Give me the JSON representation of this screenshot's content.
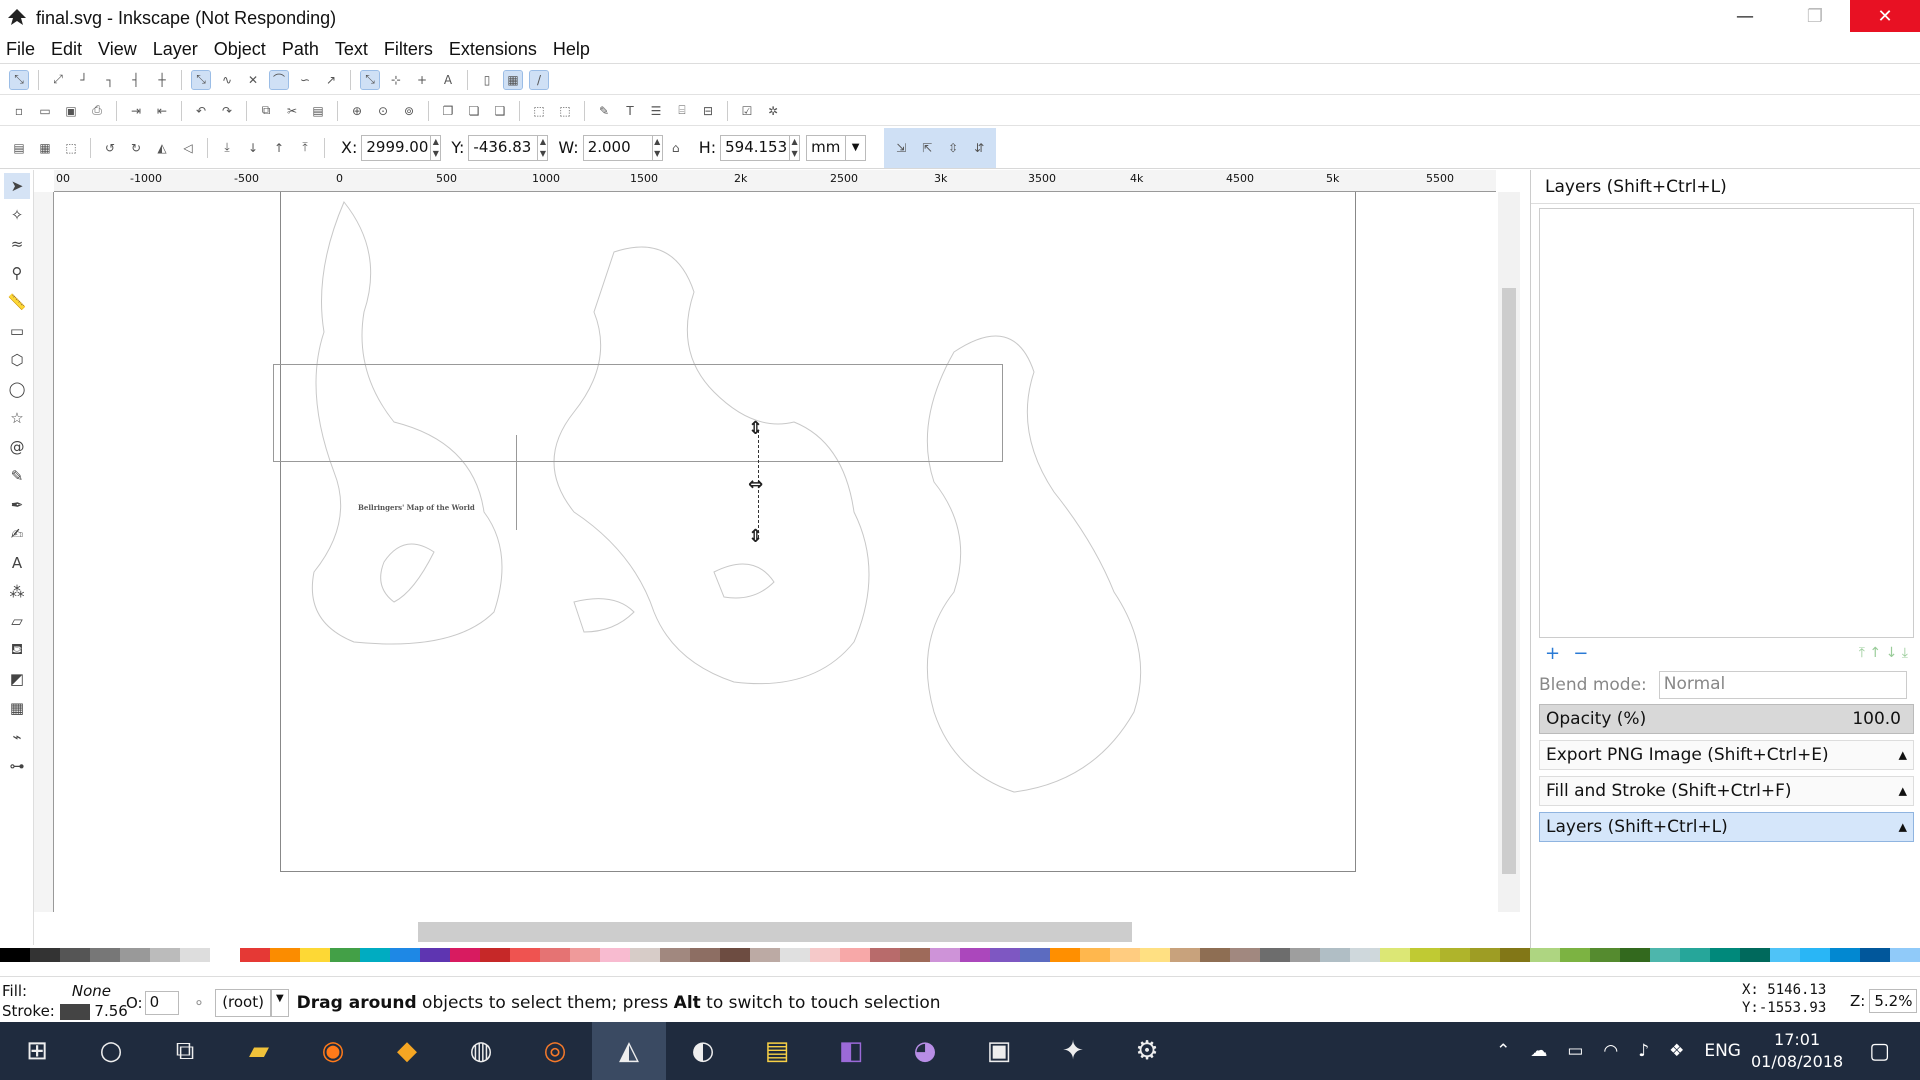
{
  "window": {
    "title": "final.svg - Inkscape (Not Responding)",
    "minimize": "—",
    "maximize": "❐",
    "close": "✕"
  },
  "menu": [
    "File",
    "Edit",
    "View",
    "Layer",
    "Object",
    "Path",
    "Text",
    "Filters",
    "Extensions",
    "Help"
  ],
  "toolbar": {
    "x_label": "X:",
    "x_value": "2999.00",
    "y_label": "Y:",
    "y_value": "-436.83",
    "w_label": "W:",
    "w_value": "2.000",
    "h_label": "H:",
    "h_value": "594.153",
    "unit": "mm"
  },
  "ruler": {
    "h_ticks": [
      "00",
      "-1000",
      "-500",
      "0",
      "500",
      "1000",
      "1500",
      "2k",
      "2500",
      "3k",
      "3500",
      "4k",
      "4500",
      "5k",
      "5500"
    ]
  },
  "canvas": {
    "map_title": "Bellringers' Map of the World"
  },
  "layers_panel": {
    "title": "Layers (Shift+Ctrl+L)",
    "blend_label": "Blend mode:",
    "blend_value": "Normal",
    "opacity_label": "Opacity (%)",
    "opacity_value": "100.0",
    "docks": [
      "Export PNG Image (Shift+Ctrl+E)",
      "Fill and Stroke (Shift+Ctrl+F)",
      "Layers (Shift+Ctrl+L)"
    ]
  },
  "palette_colors": [
    "#000000",
    "#333333",
    "#555555",
    "#777777",
    "#999999",
    "#bbbbbb",
    "#dddddd",
    "#ffffff",
    "#e53935",
    "#fb8c00",
    "#fdd835",
    "#43a047",
    "#00acc1",
    "#1e88e5",
    "#5e35b1",
    "#d81b60",
    "#c62828",
    "#ef5350",
    "#e57373",
    "#ef9a9a",
    "#f8bbd0",
    "#d7ccc8",
    "#a1887f",
    "#8d6e63",
    "#6d4c41",
    "#bcaaa4",
    "#e0e0e0",
    "#f5c9c9",
    "#f7a8a8",
    "#b86b6b",
    "#9e6a5a",
    "#ce93d8",
    "#ab47bc",
    "#7e57c2",
    "#5c6bc0",
    "#ff8f00",
    "#ffb74d",
    "#ffcc80",
    "#ffe082",
    "#c8a27c",
    "#8e6e53",
    "#a1887f",
    "#6d6d6d",
    "#9e9e9e",
    "#b0bec5",
    "#cfd8dc",
    "#dce775",
    "#c0ca33",
    "#afb42b",
    "#9e9d24",
    "#827717",
    "#aed581",
    "#7cb342",
    "#558b2f",
    "#33691e",
    "#4db6ac",
    "#26a69a",
    "#00897b",
    "#00695c",
    "#4fc3f7",
    "#29b6f6",
    "#0288d1",
    "#01579b",
    "#90caf9"
  ],
  "status": {
    "fill_label": "Fill:",
    "fill_value": "None",
    "stroke_label": "Stroke:",
    "stroke_value": "7.56",
    "opacity_label": "O:",
    "opacity_value": "0",
    "layer": "(root)",
    "message_bold1": "Drag around",
    "message1": " objects to select them; press ",
    "message_bold2": "Alt",
    "message2": " to switch to touch selection",
    "cursor_x": "X:  5146.13",
    "cursor_y": "Y:-1553.93",
    "zoom_label": "Z:",
    "zoom_value": "5.2%"
  },
  "taskbar": {
    "tray_lang": "ENG",
    "time": "17:01",
    "date": "01/08/2018"
  }
}
